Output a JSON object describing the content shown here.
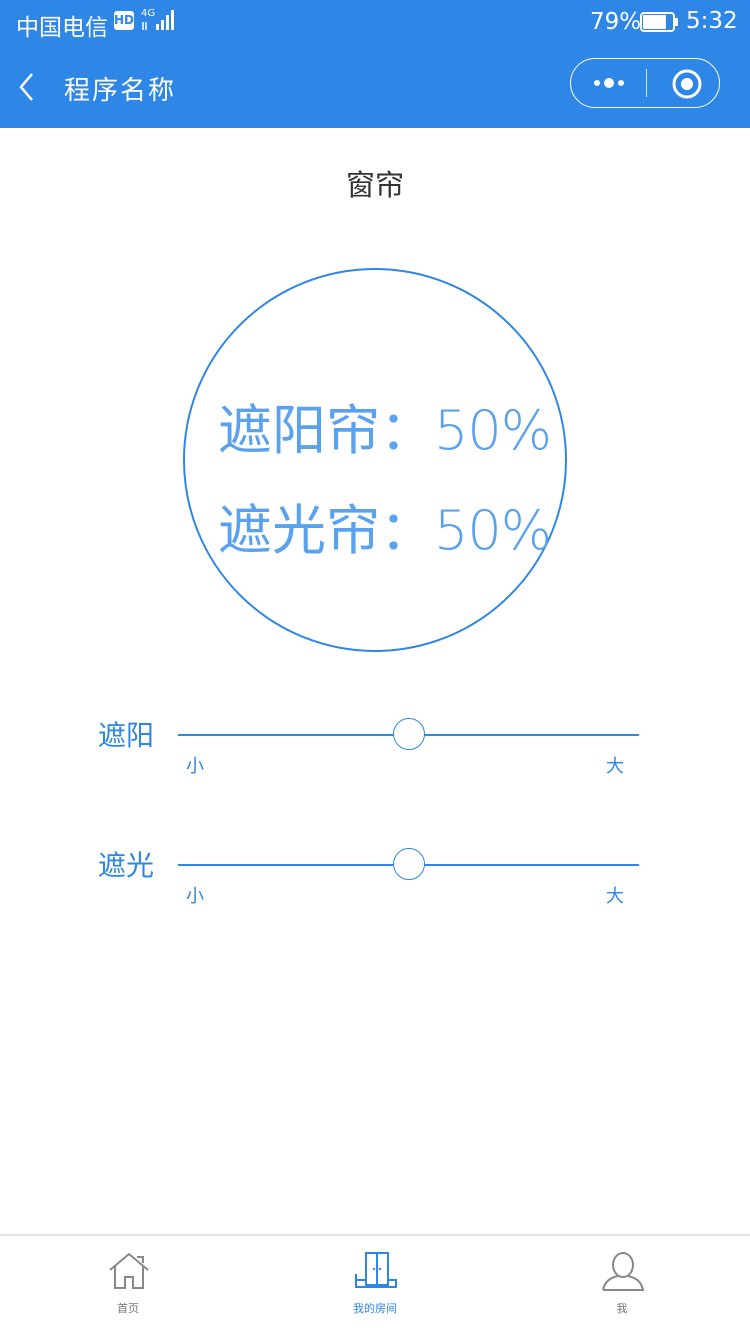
{
  "status_bar": {
    "carrier": "中国电信",
    "hd_badge": "HD",
    "network": "4G",
    "battery": "79%",
    "battery_level": 0.79,
    "time": "5:32"
  },
  "nav": {
    "title": "程序名称",
    "back_icon": "chevron-left-icon",
    "more_icon": "more-dots-icon",
    "close_icon": "target-icon"
  },
  "page": {
    "title": "窗帘"
  },
  "status_circle": {
    "lines": [
      {
        "label": "遮阳帘：",
        "value": "50%"
      },
      {
        "label": "遮光帘：",
        "value": "50%"
      }
    ]
  },
  "sliders": [
    {
      "label": "遮阳",
      "min_label": "小",
      "max_label": "大",
      "value": 0.5
    },
    {
      "label": "遮光",
      "min_label": "小",
      "max_label": "大",
      "value": 0.5
    }
  ],
  "tabbar": {
    "items": [
      {
        "label": "首页",
        "icon": "home-icon",
        "active": false
      },
      {
        "label": "我的房间",
        "icon": "room-door-icon",
        "active": true
      },
      {
        "label": "我",
        "icon": "user-icon",
        "active": false
      }
    ]
  },
  "colors": {
    "primary": "#2e86e6",
    "text_light": "#5aa2ee",
    "tab_inactive": "#777777"
  }
}
